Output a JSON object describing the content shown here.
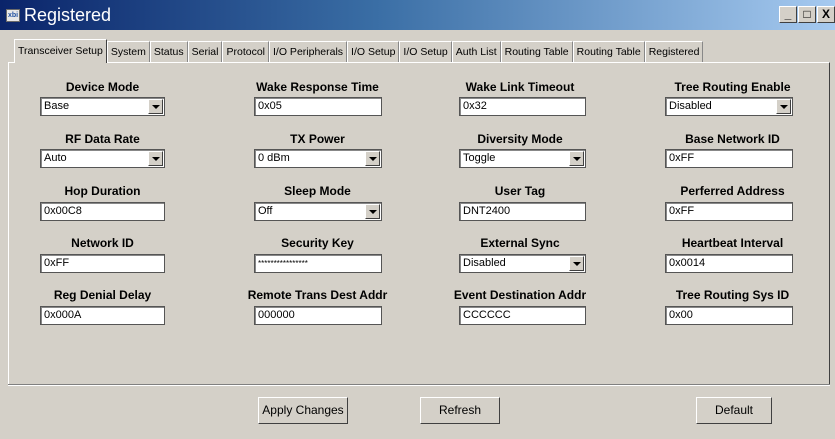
{
  "window": {
    "title": "Registered",
    "icon_name": "app-icon",
    "icon_text": "xbi",
    "minimize": "_",
    "maximize": "□",
    "close": "X"
  },
  "tabs": [
    {
      "label": "Transceiver Setup"
    },
    {
      "label": "System"
    },
    {
      "label": "Status"
    },
    {
      "label": "Serial"
    },
    {
      "label": "Protocol"
    },
    {
      "label": "I/O Peripherals"
    },
    {
      "label": "I/O Setup"
    },
    {
      "label": "I/O Setup"
    },
    {
      "label": "Auth List"
    },
    {
      "label": "Routing Table"
    },
    {
      "label": "Routing Table"
    },
    {
      "label": "Registered"
    }
  ],
  "fields": {
    "device_mode": {
      "label": "Device Mode",
      "value": "Base"
    },
    "wake_response_time": {
      "label": "Wake Response Time",
      "value": "0x05"
    },
    "wake_link_timeout": {
      "label": "Wake Link Timeout",
      "value": "0x32"
    },
    "tree_routing_enable": {
      "label": "Tree Routing Enable",
      "value": "Disabled"
    },
    "rf_data_rate": {
      "label": "RF Data Rate",
      "value": "Auto"
    },
    "tx_power": {
      "label": "TX Power",
      "value": "0 dBm"
    },
    "diversity_mode": {
      "label": "Diversity Mode",
      "value": "Toggle"
    },
    "base_network_id": {
      "label": "Base Network ID",
      "value": "0xFF"
    },
    "hop_duration": {
      "label": "Hop Duration",
      "value": "0x00C8"
    },
    "sleep_mode": {
      "label": "Sleep Mode",
      "value": "Off"
    },
    "user_tag": {
      "label": "User Tag",
      "value": "DNT2400"
    },
    "perferred_address": {
      "label": "Perferred Address",
      "value": "0xFF"
    },
    "network_id": {
      "label": "Network ID",
      "value": "0xFF"
    },
    "security_key": {
      "label": "Security Key",
      "value": "****************"
    },
    "external_sync": {
      "label": "External Sync",
      "value": "Disabled"
    },
    "heartbeat_interval": {
      "label": "Heartbeat Interval",
      "value": "0x0014"
    },
    "reg_denial_delay": {
      "label": "Reg Denial Delay",
      "value": "0x000A"
    },
    "remote_trans_dest_addr": {
      "label": "Remote Trans Dest Addr",
      "value": "000000"
    },
    "event_destination_addr": {
      "label": "Event Destination Addr",
      "value": "CCCCCC"
    },
    "tree_routing_sys_id": {
      "label": "Tree Routing Sys ID",
      "value": "0x00"
    }
  },
  "buttons": {
    "apply": "Apply Changes",
    "refresh": "Refresh",
    "default": "Default"
  }
}
